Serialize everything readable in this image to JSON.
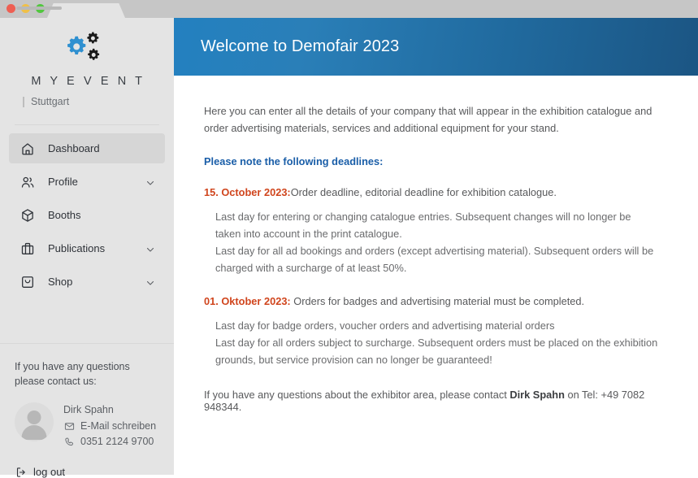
{
  "browser": {
    "tab_title": "",
    "traffic_lights": [
      "close",
      "minimize",
      "maximize"
    ]
  },
  "sidebar": {
    "logo_icon": "gears-icon",
    "brand_name": "M Y E V E N T",
    "brand_location": "Stuttgart",
    "nav": [
      {
        "label": "Dashboard",
        "icon": "home-icon",
        "active": true,
        "expandable": false
      },
      {
        "label": "Profile",
        "icon": "users-icon",
        "active": false,
        "expandable": true
      },
      {
        "label": "Booths",
        "icon": "cube-icon",
        "active": false,
        "expandable": false
      },
      {
        "label": "Publications",
        "icon": "briefcase-icon",
        "active": false,
        "expandable": true
      },
      {
        "label": "Shop",
        "icon": "shopping-bag-icon",
        "active": false,
        "expandable": true
      }
    ],
    "contact": {
      "lead": "If you have any questions please contact us:",
      "name": "Dirk Spahn",
      "email_label": "E-Mail schreiben",
      "phone_label": "0351 2124 9700",
      "avatar_icon": "user-avatar-icon",
      "email_icon": "envelope-icon",
      "phone_icon": "phone-icon"
    },
    "logout": {
      "label": "log out",
      "icon": "logout-icon"
    }
  },
  "banner": {
    "title": "Welcome to Demofair 2023",
    "gradient_from": "#2380c0",
    "gradient_to": "#1b5583"
  },
  "content": {
    "intro": "Here you can enter all the details of your company that will appear in the exhibition catalogue and order advertising materials, services and additional equipment for your stand.",
    "deadlines_heading": "Please note the following deadlines:",
    "deadlines_heading_color": "#1a5ea8",
    "date_color": "#d0451d",
    "deadlines": [
      {
        "date": "15. October 2023:",
        "summary": "Order deadline, editorial deadline for exhibition catalogue.",
        "details": "Last day for entering or changing catalogue entries. Subsequent changes will no longer be taken into account in the print catalogue.\nLast day for all ad bookings and orders (except advertising material). Subsequent orders will be charged with a surcharge of at least 50%."
      },
      {
        "date": "01. Oktober 2023:",
        "summary": " Orders for badges and advertising material must be completed.",
        "details": "Last day for badge orders, voucher orders and advertising material orders\nLast day for all orders subject to surcharge. Subsequent orders must be placed on the exhibition grounds, but service provision can no longer be guaranteed!"
      }
    ],
    "footer_prefix": "If you have any questions about the exhibitor area, please contact ",
    "footer_contact_name": "Dirk Spahn",
    "footer_suffix": " on Tel: +49 7082 948344."
  }
}
